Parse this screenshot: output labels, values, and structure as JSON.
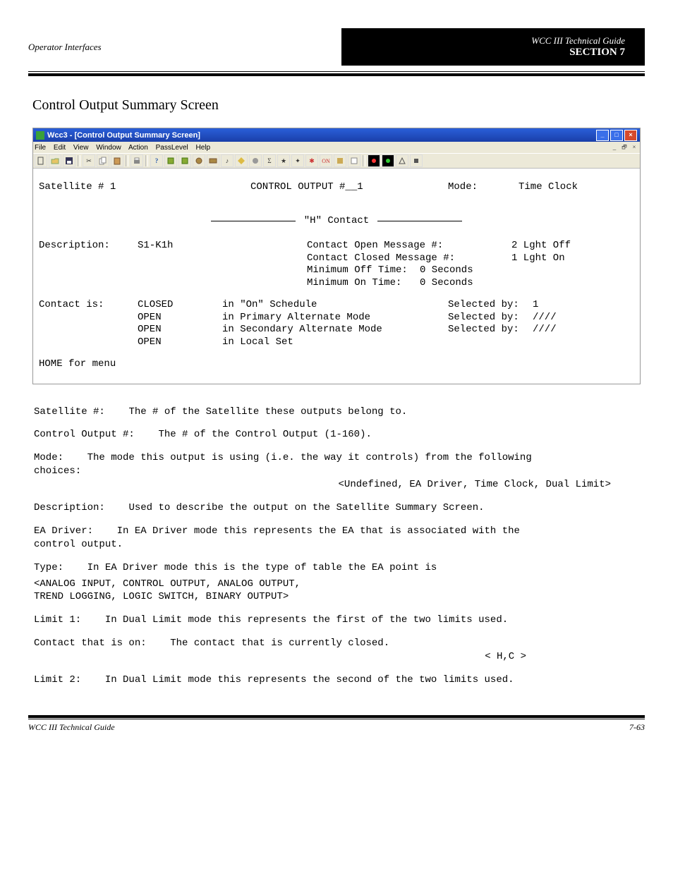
{
  "page_header": {
    "left": "Operator Interfaces",
    "right_line1": "WCC III Technical Guide",
    "right_line2": "SECTION 7"
  },
  "section_title": "Control Output Summary Screen",
  "window": {
    "title": "Wcc3 - [Control Output Summary Screen]",
    "menus": [
      "File",
      "Edit",
      "View",
      "Window",
      "Action",
      "PassLevel",
      "Help"
    ],
    "window_controls": {
      "min": "_",
      "max": "□",
      "close": "×"
    },
    "doc_controls": {
      "min": "_",
      "restore": "🗗",
      "close": "×"
    }
  },
  "screen": {
    "sat_label": "Satellite # 1",
    "co_label": "CONTROL OUTPUT #__1",
    "mode_label": "Mode:",
    "mode_value": "Time Clock",
    "h_contact": "\"H\" Contact",
    "desc_label": "Description:",
    "desc_value": "S1-K1h",
    "open_msg_label": "Contact Open Message #:",
    "open_msg_value": "2 Lght Off",
    "closed_msg_label": "Contact Closed Message #:",
    "closed_msg_value": "1 Lght On",
    "min_off_label": "Minimum Off Time:",
    "min_off_value": "0 Seconds",
    "min_on_label": "Minimum On  Time:",
    "min_on_value": "0 Seconds",
    "contact_is_label": "Contact is:",
    "rows": [
      {
        "state": "CLOSED",
        "where": "in \"On\" Schedule",
        "sel_label": "Selected by:",
        "sel": "1"
      },
      {
        "state": "OPEN",
        "where": "in Primary Alternate Mode",
        "sel_label": "Selected by:",
        "sel": "////"
      },
      {
        "state": "OPEN",
        "where": "in Secondary Alternate Mode",
        "sel_label": "Selected by:",
        "sel": "////"
      },
      {
        "state": "OPEN",
        "where": "in Local Set",
        "sel_label": "",
        "sel": ""
      }
    ],
    "home": "HOME for menu"
  },
  "explain": {
    "sat": {
      "label": "Satellite #:",
      "text": "The # of the Satellite these outputs belong to."
    },
    "co_num": {
      "label": "Control Output #:",
      "text": "The # of the Control Output (1-160)."
    },
    "mode": {
      "label": "Mode:",
      "text1": "The mode this output is using (i.e. the way it controls) from the following",
      "text2": "choices:",
      "choices": "<Undefined, EA Driver, Time Clock, Dual Limit>"
    },
    "desc": {
      "label": "Description:",
      "text": "Used to describe the output on the Satellite Summary Screen."
    },
    "ea_driver": {
      "label": "EA Driver:",
      "text": "In EA Driver mode this represents the EA that is associated with the\ncontrol output."
    },
    "type": {
      "label": "Type:",
      "text": "In EA Driver mode this is the type of table the EA point is",
      "choices": "<ANALOG INPUT, CONTROL OUTPUT, ANALOG OUTPUT,\n TREND LOGGING, LOGIC SWITCH, BINARY OUTPUT>"
    },
    "limit1": {
      "label": "Limit 1:",
      "text": "In Dual Limit mode this represents the first of the two limits used."
    },
    "contact_on": {
      "label": "Contact that is on:",
      "text": "The contact that is currently closed.",
      "choices": "< H,C >"
    },
    "limit2": {
      "label": "Limit 2:",
      "text": "In Dual Limit mode this represents the second of the two limits used."
    }
  },
  "footer": {
    "left": "WCC III Technical Guide",
    "right": "7-63"
  }
}
